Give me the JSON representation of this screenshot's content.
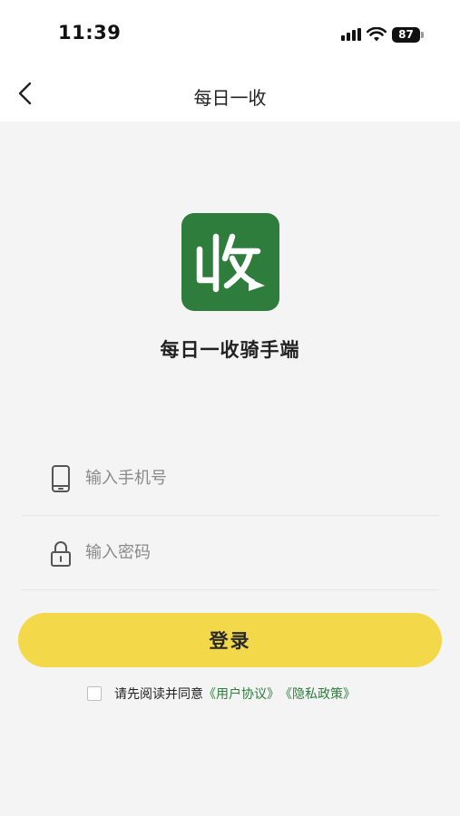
{
  "status_bar": {
    "time": "11:39",
    "battery": "87",
    "icons": [
      "signal-icon",
      "wifi-icon",
      "battery-icon"
    ]
  },
  "nav": {
    "title": "每日一收",
    "back_icon": "chevron-left-icon"
  },
  "brand": {
    "logo_char": "收",
    "app_name": "每日一收骑手端",
    "logo_color": "#2e7d3c"
  },
  "form": {
    "phone_placeholder": "输入手机号",
    "phone_icon": "phone-icon",
    "password_placeholder": "输入密码",
    "password_icon": "lock-icon",
    "login_label": "登录",
    "login_color": "#f3d84a"
  },
  "agreement": {
    "prefix": "请先阅读并同意",
    "user_agreement": "《用户协议》",
    "privacy_policy": "《隐私政策》",
    "link_color": "#2e7d3c"
  }
}
